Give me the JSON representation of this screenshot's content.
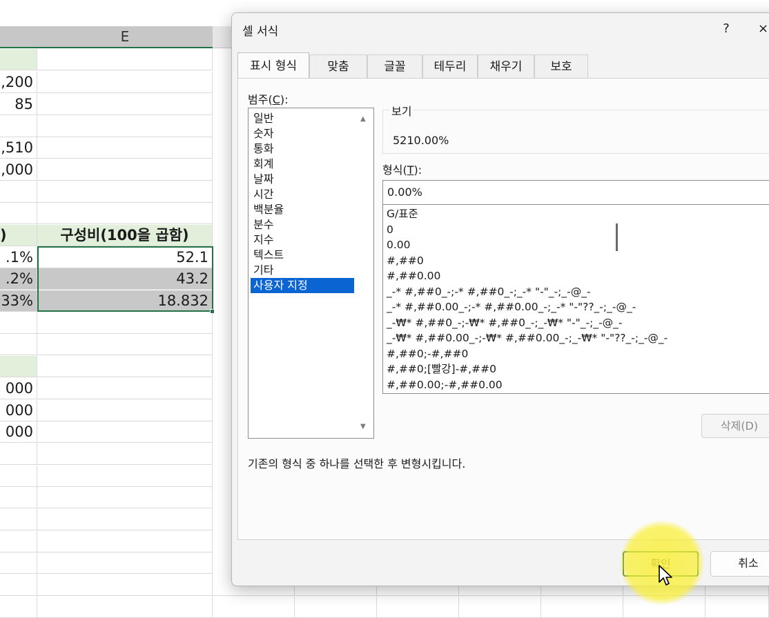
{
  "sheet": {
    "column_e_header": "E",
    "col_d": {
      "r1": ",200",
      "r2": "85",
      "r4": ",510",
      "r5": ",000",
      "h2": ")",
      "p1": ".1%",
      "p2": ".2%",
      "p3": "33%",
      "t1": "000",
      "t2": "000",
      "t3": "000"
    },
    "col_e": {
      "header": "구성비(100을 곱함)",
      "v1": "52.1",
      "v2": "43.2",
      "v3": "18.832"
    }
  },
  "dialog": {
    "title": "셀 서식",
    "help": "?",
    "close": "×",
    "tabs": [
      "표시 형식",
      "맞춤",
      "글꼴",
      "테두리",
      "채우기",
      "보호"
    ],
    "category_label_prefix": "범주(",
    "category_label_key": "C",
    "category_label_suffix": "):",
    "categories": [
      "일반",
      "숫자",
      "통화",
      "회계",
      "날짜",
      "시간",
      "백분율",
      "분수",
      "지수",
      "텍스트",
      "기타",
      "사용자 지정"
    ],
    "selected_category": "사용자 지정",
    "sample_label": "보기",
    "sample_value": "5210.00%",
    "type_label_prefix": "형식(",
    "type_label_key": "T",
    "type_label_suffix": "):",
    "type_value": "0.00%",
    "formats": [
      "G/표준",
      "0",
      "0.00",
      "#,##0",
      "#,##0.00",
      "_-* #,##0_-;-* #,##0_-;_-* \"-\"_-;_-@_-",
      "_-* #,##0.00_-;-* #,##0.00_-;_-* \"-\"??_-;_-@_-",
      "_-₩* #,##0_-;-₩* #,##0_-;_-₩* \"-\"_-;_-@_-",
      "_-₩* #,##0.00_-;-₩* #,##0.00_-;_-₩* \"-\"??_-;_-@_-",
      "#,##0;-#,##0",
      "#,##0;[빨강]-#,##0",
      "#,##0.00;-#,##0.00"
    ],
    "delete_button": "삭제(D)",
    "description": "기존의 형식 중 하나를 선택한 후 변형시킵니다.",
    "ok_button": "확인",
    "cancel_button": "취소",
    "colors": {
      "accent": "#0a64d2",
      "excel_green": "#217346",
      "highlight": "#f5ec3c"
    }
  }
}
